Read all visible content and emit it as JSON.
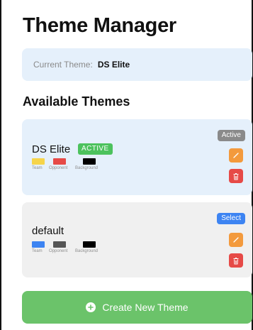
{
  "header": {
    "title": "Theme Manager"
  },
  "current": {
    "label": "Current Theme:",
    "value": "DS Elite"
  },
  "section": {
    "title": "Available Themes"
  },
  "themes": [
    {
      "name": "DS Elite",
      "badge": "ACTIVE",
      "state_button": "Active",
      "swatches": [
        {
          "label": "Team",
          "color": "#f6d44a"
        },
        {
          "label": "Opponent",
          "color": "#e64a47"
        },
        {
          "label": "Background",
          "color": "#000000"
        }
      ]
    },
    {
      "name": "default",
      "state_button": "Select",
      "swatches": [
        {
          "label": "Team",
          "color": "#3d84f2"
        },
        {
          "label": "Opponent",
          "color": "#555555"
        },
        {
          "label": "Background",
          "color": "#000000"
        }
      ]
    }
  ],
  "actions": {
    "create_label": "Create New Theme"
  },
  "icons": {
    "edit": "pencil-icon",
    "delete": "trash-icon",
    "create": "plus-circle-icon"
  },
  "colors": {
    "edit_button": "#f39a3d",
    "delete_button": "#e64a47",
    "select_button": "#3d84f2",
    "active_pill": "#8a8a8a",
    "active_badge": "#4cc25d",
    "create_button": "#6bc36a"
  }
}
